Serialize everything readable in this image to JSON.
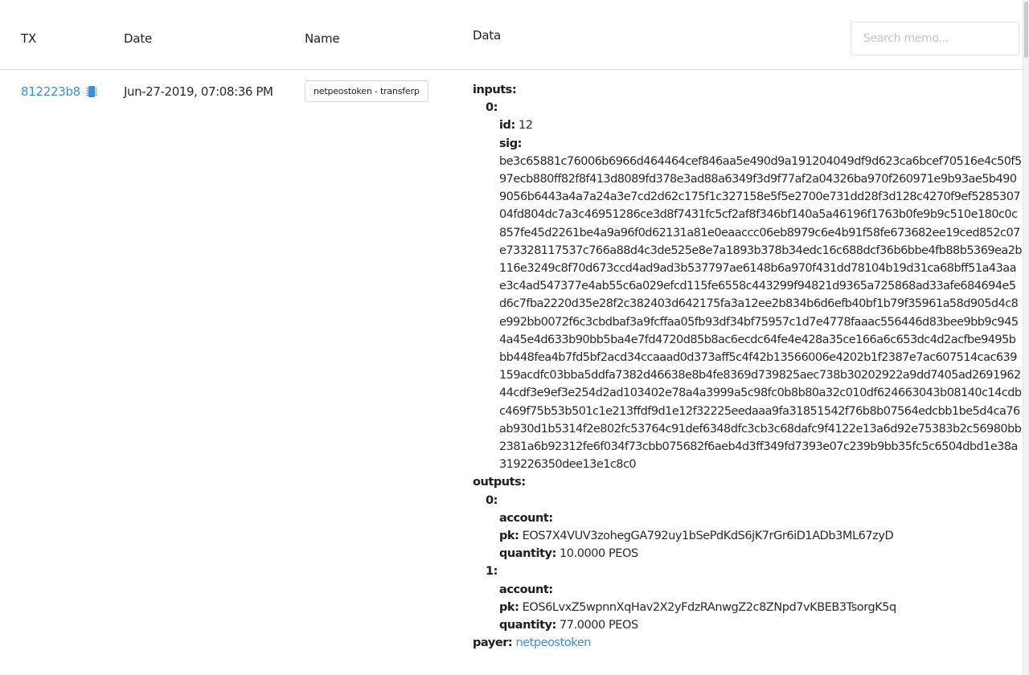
{
  "table": {
    "headers": {
      "tx": "TX",
      "date": "Date",
      "name": "Name",
      "data": "Data"
    },
    "search": {
      "placeholder": "Search memo..."
    }
  },
  "row": {
    "tx": "812223b8",
    "tx_icon": "chip-icon",
    "date": "Jun-27-2019, 07:08:36 PM",
    "name": "netpeostoken - transferp",
    "data": {
      "inputs_label": "inputs:",
      "inputs": [
        {
          "index_label": "0:",
          "id_key": "id:",
          "id_value": "12",
          "sig_key": "sig:",
          "sig_value": "be3c65881c76006b6966d464464cef846aa5e490d9a191204049df9d623ca6bcef70516e4c50f597ecb880ff82f8f413d8089fd378e3ad88a6349f3d9f77af2a04326ba970f260971e9b93ae5b4909056b6443a4a7a24a3e7cd2d62c175f1c327158e5f5e2700e731dd28f3d128c4270f9ef528530704fd804dc7a3c46951286ce3d8f7431fc5cf2af8f346bf140a5a46196f1763b0fe9b9c510e180c0c857fe45d2261be4a9a96f0d62131a81e0eaaccc06eb8979c6e4b91f58fe673682ee19ced852c07e73328117537c766a88d4c3de525e8e7a1893b378b34edc16c688dcf36b6bbe4fb88b5369ea2b116e3249c8f70d673ccd4ad9ad3b537797ae6148b6a970f431dd78104b19d31ca68bff51a43aae3c4ad547377e4ab55c6a029efcd115fe6558c443299f94821d9365a725868ad33afe684694e5d6c7fba2220d35e28f2c382403d642175fa3a12ee2b834b6d6efb40bf1b79f35961a58d905d4c8e992bb0072f6c3cbdbaf3a9fcffaa05fb93df34bf75957c1d7e4778faaac556446d83bee9bb9c9454a45e4d633b90bb5ba4e7fd4720d85b8ac6ecdc64fe4e428a35ce166a6c653dc4d2acfbe9495bbb448fea4b7fd5bf2acd34ccaaad0d373aff5c4f42b13566006e4202b1f2387e7ac607514cac639159acdfc03bba5ddfa7382d46638e8b4fe8369d739825aec738b30202922a9dd7405ad269196244cdf3e9ef3e254d2ad103402e78a4a3999a5c98fc0b8b80a32c010df624663043b08140c14cdbc469f75b53b501c1e213ffdf9d1e12f32225eedaaa9fa31851542f76b8b07564edcbb1be5d4ca76ab930d1b5314f2e802fc53764c91def6348dfc3cb3c68dafc9f4122e13a6d92e75383b2c56980bb2381a6b92312fe6f034f73cbb075682f6aeb4d3ff349fd7393e07c239b9bb35fc5c6504dbd1e38a319226350dee13e1c8c0"
        }
      ],
      "outputs_label": "outputs:",
      "outputs": [
        {
          "index_label": "0:",
          "account_key": "account:",
          "pk_key": "pk:",
          "pk_value": "EOS7X4VUV3zohegGA792uy1bSePdKdS6jK7rGr6iD1ADb3ML67zyD",
          "quantity_key": "quantity:",
          "quantity_value": "10.0000 PEOS"
        },
        {
          "index_label": "1:",
          "account_key": "account:",
          "pk_key": "pk:",
          "pk_value": "EOS6LvxZ5wpnnXqHav2X2yFdzRAnwgZ2c8ZNpd7vKBEB3TsorgK5q",
          "quantity_key": "quantity:",
          "quantity_value": "77.0000 PEOS"
        }
      ],
      "payer_key": "payer:",
      "payer_value": "netpeostoken"
    }
  },
  "colors": {
    "link": "#3a8fd6",
    "border": "#e2e2e2"
  }
}
